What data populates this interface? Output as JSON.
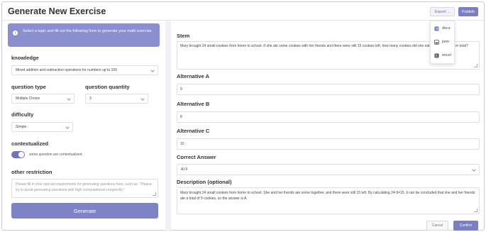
{
  "header": {
    "title": "Generate New Exercise",
    "export_label": "Export",
    "publish_label": "Publish",
    "export_menu": [
      {
        "label": "docx",
        "icon": "word-doc-icon"
      },
      {
        "label": "json",
        "icon": "json-file-icon"
      },
      {
        "label": "excel",
        "icon": "excel-file-icon"
      }
    ]
  },
  "left": {
    "info": "Select a topic and fill out the following form to generate your math exercise",
    "knowledge_label": "knowledge",
    "knowledge_value": "Mixed addition and subtraction operations for numbers up to 100",
    "question_type_label": "question type",
    "question_type_value": "Multiple Choice",
    "question_quantity_label": "question quantity",
    "question_quantity_value": "3",
    "difficulty_label": "difficulty",
    "difficulty_value": "Simple",
    "contextualized_label": "contextualized",
    "contextualized_toggle_text": "some question are contextualized",
    "other_restriction_label": "other restriction",
    "other_restriction_placeholder": "Please fill in your special requirements for generating questions here, such as: \"Please try to avoid generating questions with high computational complexity.\"",
    "generate_label": "Generate"
  },
  "right": {
    "stem_label": "Stem",
    "stem_value": "Mary brought 24 small cookies from home to school. If she ate some cookies with her friends and there were still 15 cookies left, how many cookies did she eat with her friends in total?",
    "alt_a_label": "Alternative A",
    "alt_a_value": "9",
    "alt_b_label": "Alternative B",
    "alt_b_value": "8",
    "alt_c_label": "Alternative C",
    "alt_c_value": "10",
    "correct_label": "Correct Answer",
    "correct_value": "A) 9",
    "description_label": "Description (optional)",
    "description_value": "Mary brought 24 small cookies from home to school. She and her friends ate some together, and there were still 15 left. By calculating 24-9=15, it can be concluded that she and her friends ate a total of 9 cookies, so the answer is A.",
    "cancel_label": "Cancel",
    "confirm_label": "Confirm"
  },
  "colors": {
    "accent": "#7a7fc4",
    "banner": "#8a8fcf"
  }
}
